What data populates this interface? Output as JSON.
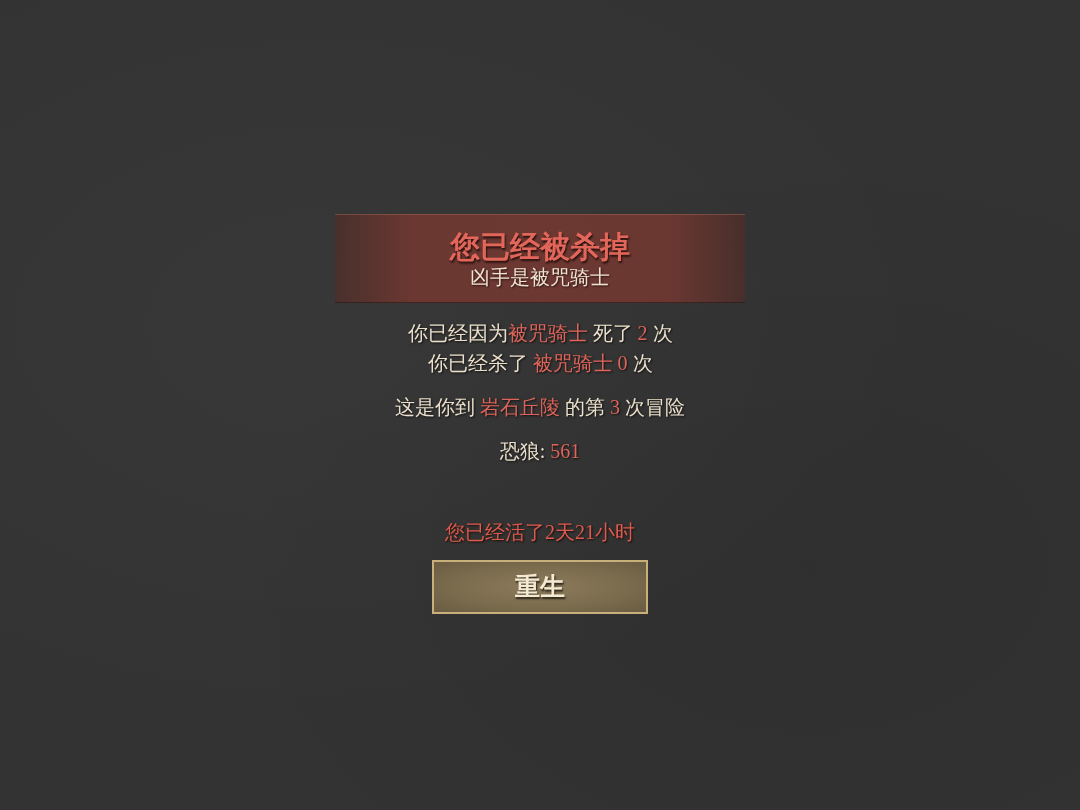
{
  "banner": {
    "title": "您已经被杀掉",
    "subtitle": "凶手是被咒骑士"
  },
  "sections": [
    {
      "lines": [
        {
          "segments": [
            {
              "text": "你已经因为",
              "highlight": false
            },
            {
              "text": "被咒骑士",
              "highlight": true
            },
            {
              "text": " 死了 ",
              "highlight": false
            },
            {
              "text": "2",
              "highlight": true
            },
            {
              "text": " 次",
              "highlight": false
            }
          ]
        },
        {
          "segments": [
            {
              "text": "你已经杀了 ",
              "highlight": false
            },
            {
              "text": "被咒骑士 0",
              "highlight": true
            },
            {
              "text": " 次",
              "highlight": false
            }
          ]
        }
      ]
    },
    {
      "lines": [
        {
          "segments": [
            {
              "text": "这是你到 ",
              "highlight": false
            },
            {
              "text": "岩石丘陵",
              "highlight": true
            },
            {
              "text": " 的第 ",
              "highlight": false
            },
            {
              "text": "3",
              "highlight": true
            },
            {
              "text": " 次冒险",
              "highlight": false
            }
          ]
        }
      ]
    },
    {
      "lines": [
        {
          "segments": [
            {
              "text": "恐狼: ",
              "highlight": false
            },
            {
              "text": "561",
              "highlight": true
            }
          ]
        }
      ]
    }
  ],
  "survival": "您已经活了2天21小时",
  "buttons": [
    {
      "label": "重生"
    }
  ]
}
